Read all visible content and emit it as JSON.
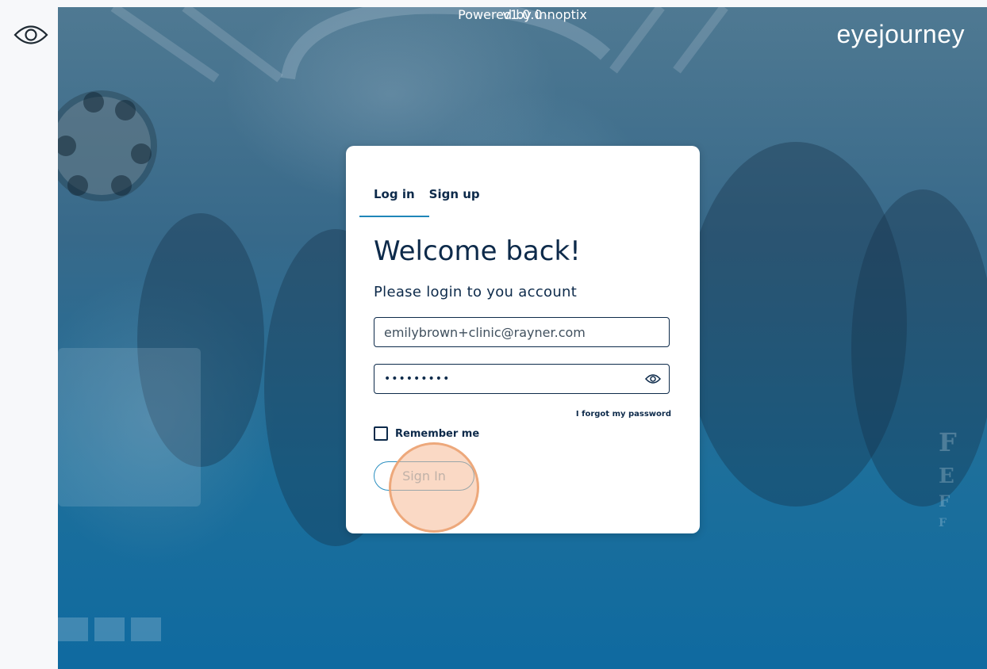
{
  "app": {
    "brand": "eyejourney"
  },
  "sidebar": {
    "icon": "eye-icon"
  },
  "login_card": {
    "tabs": [
      {
        "label": "Log in",
        "active": true
      },
      {
        "label": "Sign up",
        "active": false
      }
    ],
    "title": "Welcome back!",
    "subtitle": "Please login to you account",
    "email_value": "emilybrown+clinic@rayner.com",
    "password_value": "•••••••••",
    "forgot_password": "I forgot my password",
    "remember_me": "Remember me",
    "sign_in": "Sign In"
  },
  "footer": {
    "powered_by": "Powered by innoptix",
    "version": "v1.0.0"
  },
  "colors": {
    "primary_text": "#0d2a4a",
    "accent": "#1f86b8",
    "background_top": "#4f7992",
    "background_bottom": "#0f6aa0"
  }
}
